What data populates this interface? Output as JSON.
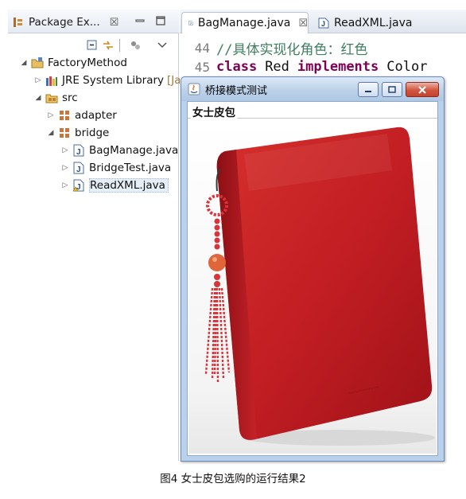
{
  "package_explorer": {
    "tab_title": "Package Ex...",
    "close_glyph": "☒",
    "tree": {
      "project": "FactoryMethod",
      "jre_library": "JRE System Library",
      "jre_suffix": "[Jav",
      "src": "src",
      "pkg_adapter": "adapter",
      "pkg_bridge": "bridge",
      "files": [
        "BagManage.java",
        "BridgeTest.java",
        "ReadXML.java"
      ]
    }
  },
  "editor": {
    "tabs": [
      {
        "label": "BagManage.java",
        "active": true
      },
      {
        "label": "ReadXML.java",
        "active": false
      }
    ],
    "lines": [
      {
        "number": "44",
        "comment": "//具体实现化角色：红色"
      },
      {
        "number": "45",
        "keyword1": "class",
        "name": "Red",
        "keyword2": "implements",
        "rest": "Color"
      }
    ]
  },
  "swing_window": {
    "title": "桥接模式测试",
    "group_label": "女士皮包"
  },
  "caption": "图4 女士皮包选购的运行结果2",
  "colors": {
    "wallet_red": "#c21e23",
    "comment_green": "#3f7f5f",
    "keyword_purple": "#7f0055",
    "title_blue": "#bcd2ea"
  }
}
